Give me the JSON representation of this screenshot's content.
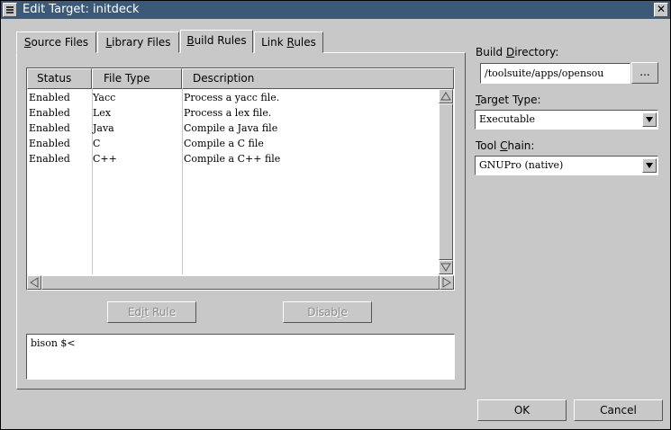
{
  "window": {
    "title": "Edit Target: initdeck",
    "close_glyph": "✕"
  },
  "tabs": [
    {
      "pre": "",
      "accel": "S",
      "post": "ource Files"
    },
    {
      "pre": "",
      "accel": "L",
      "post": "ibrary Files"
    },
    {
      "pre": "",
      "accel": "B",
      "post": "uild Rules"
    },
    {
      "pre": "Link ",
      "accel": "R",
      "post": "ules"
    }
  ],
  "active_tab_index": 2,
  "rules_table": {
    "columns": [
      "Status",
      "File Type",
      "Description"
    ],
    "rows": [
      [
        "Enabled",
        "Yacc",
        "Process a yacc file."
      ],
      [
        "Enabled",
        "Lex",
        "Process a lex file."
      ],
      [
        "Enabled",
        "Java",
        "Compile a Java file"
      ],
      [
        "Enabled",
        "C",
        "Compile a C file"
      ],
      [
        "Enabled",
        "C++",
        "Compile a C++ file"
      ]
    ]
  },
  "buttons": {
    "edit_rule": {
      "pre": "Ed",
      "accel": "i",
      "post": "t Rule",
      "enabled": false
    },
    "disable": {
      "pre": "Disab",
      "accel": "l",
      "post": "e",
      "enabled": false
    },
    "ok": "OK",
    "cancel": "Cancel",
    "browse": "..."
  },
  "command_text": "bison $<",
  "right_panel": {
    "build_directory": {
      "pre": "Build ",
      "accel": "D",
      "post": "irectory:",
      "value": "/toolsuite/apps/opensou"
    },
    "target_type": {
      "pre": "",
      "accel": "T",
      "post": "arget Type:",
      "value": "Executable"
    },
    "tool_chain": {
      "pre": "Tool ",
      "accel": "C",
      "post": "hain:",
      "value": "GNUPro (native)"
    }
  },
  "icons": {
    "window_menu": "window-menu-icon",
    "close": "close-icon",
    "dropdown": "chevron-down-icon",
    "scroll_up": "arrow-up-icon",
    "scroll_down": "arrow-down-icon",
    "scroll_left": "arrow-left-icon",
    "scroll_right": "arrow-right-icon"
  },
  "colors": {
    "titlebar": "#3c5a78",
    "window_bg": "#c8c8c8",
    "disabled_text": "#8a8a8a"
  }
}
